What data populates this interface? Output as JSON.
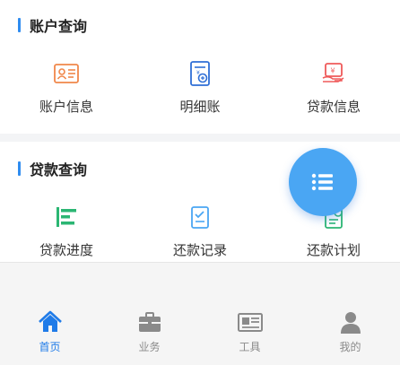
{
  "sections": [
    {
      "title": "账户查询",
      "items": [
        {
          "label": "账户信息",
          "icon": "id-card-icon"
        },
        {
          "label": "明细账",
          "icon": "ledger-document-icon"
        },
        {
          "label": "贷款信息",
          "icon": "loan-bill-icon"
        }
      ]
    },
    {
      "title": "贷款查询",
      "items": [
        {
          "label": "贷款进度",
          "icon": "progress-bars-icon"
        },
        {
          "label": "还款记录",
          "icon": "clipboard-check-icon"
        },
        {
          "label": "还款计划",
          "icon": "schedule-document-icon"
        }
      ]
    }
  ],
  "fab": {
    "icon": "list-icon"
  },
  "tabbar": [
    {
      "label": "首页",
      "icon": "home-icon",
      "active": true
    },
    {
      "label": "业务",
      "icon": "briefcase-icon",
      "active": false
    },
    {
      "label": "工具",
      "icon": "newspaper-icon",
      "active": false
    },
    {
      "label": "我的",
      "icon": "user-icon",
      "active": false
    }
  ],
  "colors": {
    "accent": "#2f8cf0",
    "fab": "#4aa6f3",
    "orange": "#f0874a",
    "blue_icon": "#2f6fd6",
    "red_icon": "#ef5a5a",
    "green_icon": "#2bb673",
    "tab_active": "#1f7be8",
    "tab_inactive": "#8a8a8a"
  }
}
